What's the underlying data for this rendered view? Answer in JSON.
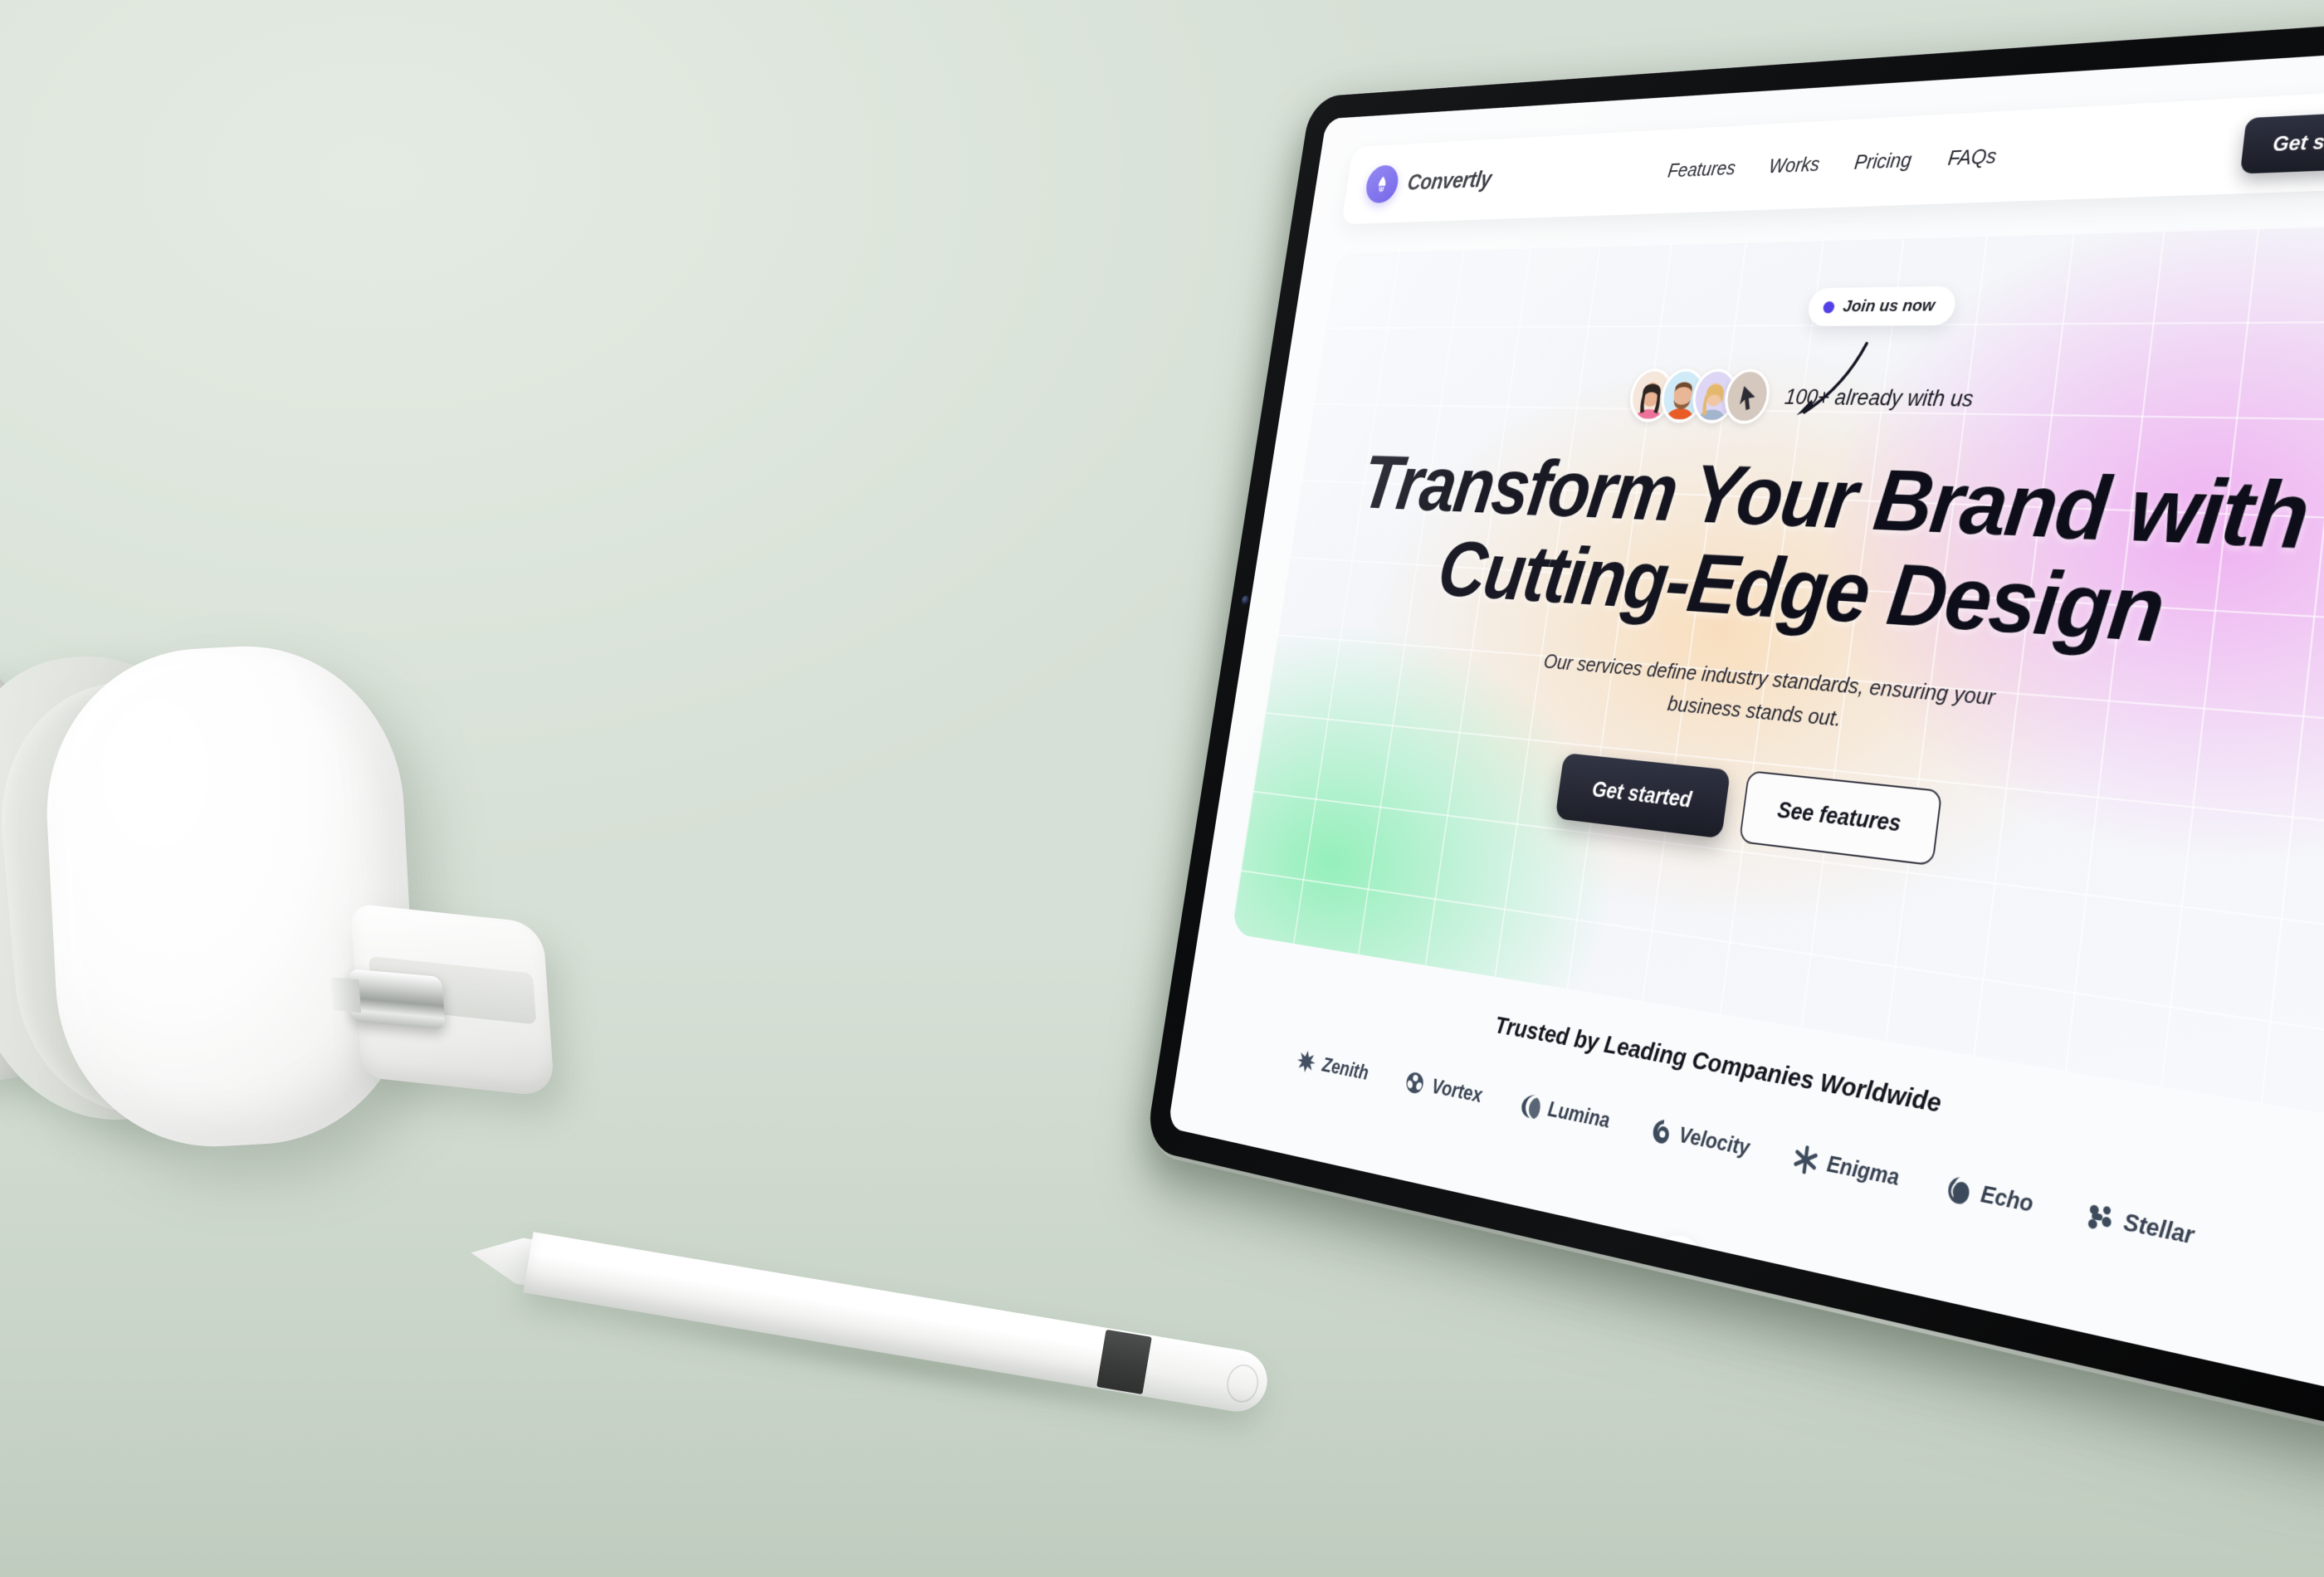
{
  "scene": {
    "background_color": "#d7e0d6",
    "objects": [
      "white-over-ear-headphones",
      "white-stylus-pen",
      "black-bezel-tablet"
    ]
  },
  "site": {
    "brand": {
      "name": "Convertly",
      "icon": "rocket-icon",
      "color": "#4a37e0"
    },
    "nav": {
      "links": [
        "Features",
        "Works",
        "Pricing",
        "FAQs"
      ],
      "cta_label": "Get started"
    },
    "hero": {
      "badge": {
        "label": "Join us now",
        "dot_color": "#4f3de8"
      },
      "social_proof": "100+ already with us",
      "avatars": [
        {
          "name": "avatar-woman-pink",
          "bg": "#f4e3d7",
          "accent": "#ec6d96"
        },
        {
          "name": "avatar-man-orange",
          "bg": "#cfe9f7",
          "accent": "#e8561f"
        },
        {
          "name": "avatar-woman-denim",
          "bg": "#dcd5f5",
          "accent": "#8fa6c4"
        },
        {
          "name": "avatar-cursor-tile",
          "bg": "#d4c7bc",
          "accent": "#2b2c35"
        }
      ],
      "headline_line1": "Transform Your Brand with",
      "headline_line2": "Cutting-Edge Design",
      "subheadline": "Our services define industry standards, ensuring your business stands out.",
      "primary_cta": "Get started",
      "secondary_cta": "See features",
      "gradient_colors": {
        "pink": "#eeaaf0",
        "green": "#87eeb2",
        "peach": "#f9ddba",
        "base": "#f6f8fb"
      }
    },
    "trusted": {
      "title": "Trusted by Leading Companies Worldwide",
      "logos": [
        {
          "name": "Zenith",
          "icon": "starburst-icon"
        },
        {
          "name": "Vortex",
          "icon": "flower-globe-icon"
        },
        {
          "name": "Lumina",
          "icon": "crescent-icon"
        },
        {
          "name": "Velocity",
          "icon": "swirl-icon"
        },
        {
          "name": "Enigma",
          "icon": "asterisk-icon"
        },
        {
          "name": "Echo",
          "icon": "spiral-shell-icon"
        },
        {
          "name": "Stellar",
          "icon": "molecule-icon"
        }
      ]
    }
  }
}
